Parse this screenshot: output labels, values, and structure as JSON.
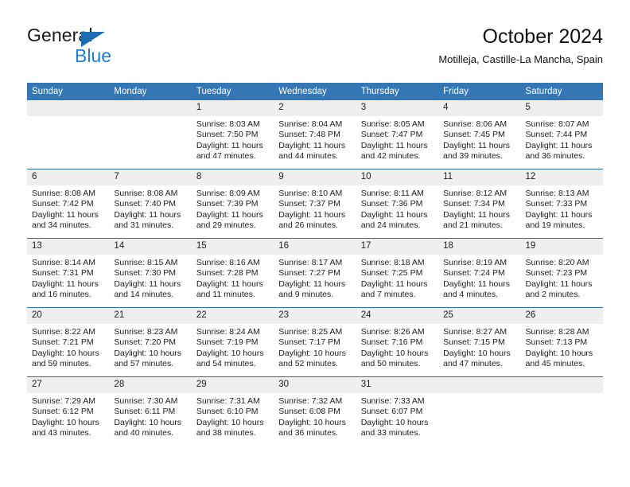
{
  "brand": {
    "name_top": "General",
    "name_bottom": "Blue",
    "accent_color": "#1b7fd0",
    "triangle_color": "#1b6cb0"
  },
  "header": {
    "title": "October 2024",
    "subtitle": "Motilleja, Castille-La Mancha, Spain"
  },
  "theme": {
    "header_blue": "#3477b4",
    "row_divider_blue": "#2f6ea8",
    "daynum_band": "#efefef"
  },
  "weekday_headers": [
    "Sunday",
    "Monday",
    "Tuesday",
    "Wednesday",
    "Thursday",
    "Friday",
    "Saturday"
  ],
  "weeks": [
    [
      {
        "day": "",
        "sunrise": "",
        "sunset": "",
        "daylight_line1": "",
        "daylight_line2": "",
        "empty": true
      },
      {
        "day": "",
        "sunrise": "",
        "sunset": "",
        "daylight_line1": "",
        "daylight_line2": "",
        "empty": true
      },
      {
        "day": "1",
        "sunrise": "Sunrise: 8:03 AM",
        "sunset": "Sunset: 7:50 PM",
        "daylight_line1": "Daylight: 11 hours",
        "daylight_line2": "and 47 minutes."
      },
      {
        "day": "2",
        "sunrise": "Sunrise: 8:04 AM",
        "sunset": "Sunset: 7:48 PM",
        "daylight_line1": "Daylight: 11 hours",
        "daylight_line2": "and 44 minutes."
      },
      {
        "day": "3",
        "sunrise": "Sunrise: 8:05 AM",
        "sunset": "Sunset: 7:47 PM",
        "daylight_line1": "Daylight: 11 hours",
        "daylight_line2": "and 42 minutes."
      },
      {
        "day": "4",
        "sunrise": "Sunrise: 8:06 AM",
        "sunset": "Sunset: 7:45 PM",
        "daylight_line1": "Daylight: 11 hours",
        "daylight_line2": "and 39 minutes."
      },
      {
        "day": "5",
        "sunrise": "Sunrise: 8:07 AM",
        "sunset": "Sunset: 7:44 PM",
        "daylight_line1": "Daylight: 11 hours",
        "daylight_line2": "and 36 minutes."
      }
    ],
    [
      {
        "day": "6",
        "sunrise": "Sunrise: 8:08 AM",
        "sunset": "Sunset: 7:42 PM",
        "daylight_line1": "Daylight: 11 hours",
        "daylight_line2": "and 34 minutes."
      },
      {
        "day": "7",
        "sunrise": "Sunrise: 8:08 AM",
        "sunset": "Sunset: 7:40 PM",
        "daylight_line1": "Daylight: 11 hours",
        "daylight_line2": "and 31 minutes."
      },
      {
        "day": "8",
        "sunrise": "Sunrise: 8:09 AM",
        "sunset": "Sunset: 7:39 PM",
        "daylight_line1": "Daylight: 11 hours",
        "daylight_line2": "and 29 minutes."
      },
      {
        "day": "9",
        "sunrise": "Sunrise: 8:10 AM",
        "sunset": "Sunset: 7:37 PM",
        "daylight_line1": "Daylight: 11 hours",
        "daylight_line2": "and 26 minutes."
      },
      {
        "day": "10",
        "sunrise": "Sunrise: 8:11 AM",
        "sunset": "Sunset: 7:36 PM",
        "daylight_line1": "Daylight: 11 hours",
        "daylight_line2": "and 24 minutes."
      },
      {
        "day": "11",
        "sunrise": "Sunrise: 8:12 AM",
        "sunset": "Sunset: 7:34 PM",
        "daylight_line1": "Daylight: 11 hours",
        "daylight_line2": "and 21 minutes."
      },
      {
        "day": "12",
        "sunrise": "Sunrise: 8:13 AM",
        "sunset": "Sunset: 7:33 PM",
        "daylight_line1": "Daylight: 11 hours",
        "daylight_line2": "and 19 minutes."
      }
    ],
    [
      {
        "day": "13",
        "sunrise": "Sunrise: 8:14 AM",
        "sunset": "Sunset: 7:31 PM",
        "daylight_line1": "Daylight: 11 hours",
        "daylight_line2": "and 16 minutes."
      },
      {
        "day": "14",
        "sunrise": "Sunrise: 8:15 AM",
        "sunset": "Sunset: 7:30 PM",
        "daylight_line1": "Daylight: 11 hours",
        "daylight_line2": "and 14 minutes."
      },
      {
        "day": "15",
        "sunrise": "Sunrise: 8:16 AM",
        "sunset": "Sunset: 7:28 PM",
        "daylight_line1": "Daylight: 11 hours",
        "daylight_line2": "and 11 minutes."
      },
      {
        "day": "16",
        "sunrise": "Sunrise: 8:17 AM",
        "sunset": "Sunset: 7:27 PM",
        "daylight_line1": "Daylight: 11 hours",
        "daylight_line2": "and 9 minutes."
      },
      {
        "day": "17",
        "sunrise": "Sunrise: 8:18 AM",
        "sunset": "Sunset: 7:25 PM",
        "daylight_line1": "Daylight: 11 hours",
        "daylight_line2": "and 7 minutes."
      },
      {
        "day": "18",
        "sunrise": "Sunrise: 8:19 AM",
        "sunset": "Sunset: 7:24 PM",
        "daylight_line1": "Daylight: 11 hours",
        "daylight_line2": "and 4 minutes."
      },
      {
        "day": "19",
        "sunrise": "Sunrise: 8:20 AM",
        "sunset": "Sunset: 7:23 PM",
        "daylight_line1": "Daylight: 11 hours",
        "daylight_line2": "and 2 minutes."
      }
    ],
    [
      {
        "day": "20",
        "sunrise": "Sunrise: 8:22 AM",
        "sunset": "Sunset: 7:21 PM",
        "daylight_line1": "Daylight: 10 hours",
        "daylight_line2": "and 59 minutes."
      },
      {
        "day": "21",
        "sunrise": "Sunrise: 8:23 AM",
        "sunset": "Sunset: 7:20 PM",
        "daylight_line1": "Daylight: 10 hours",
        "daylight_line2": "and 57 minutes."
      },
      {
        "day": "22",
        "sunrise": "Sunrise: 8:24 AM",
        "sunset": "Sunset: 7:19 PM",
        "daylight_line1": "Daylight: 10 hours",
        "daylight_line2": "and 54 minutes."
      },
      {
        "day": "23",
        "sunrise": "Sunrise: 8:25 AM",
        "sunset": "Sunset: 7:17 PM",
        "daylight_line1": "Daylight: 10 hours",
        "daylight_line2": "and 52 minutes."
      },
      {
        "day": "24",
        "sunrise": "Sunrise: 8:26 AM",
        "sunset": "Sunset: 7:16 PM",
        "daylight_line1": "Daylight: 10 hours",
        "daylight_line2": "and 50 minutes."
      },
      {
        "day": "25",
        "sunrise": "Sunrise: 8:27 AM",
        "sunset": "Sunset: 7:15 PM",
        "daylight_line1": "Daylight: 10 hours",
        "daylight_line2": "and 47 minutes."
      },
      {
        "day": "26",
        "sunrise": "Sunrise: 8:28 AM",
        "sunset": "Sunset: 7:13 PM",
        "daylight_line1": "Daylight: 10 hours",
        "daylight_line2": "and 45 minutes."
      }
    ],
    [
      {
        "day": "27",
        "sunrise": "Sunrise: 7:29 AM",
        "sunset": "Sunset: 6:12 PM",
        "daylight_line1": "Daylight: 10 hours",
        "daylight_line2": "and 43 minutes."
      },
      {
        "day": "28",
        "sunrise": "Sunrise: 7:30 AM",
        "sunset": "Sunset: 6:11 PM",
        "daylight_line1": "Daylight: 10 hours",
        "daylight_line2": "and 40 minutes."
      },
      {
        "day": "29",
        "sunrise": "Sunrise: 7:31 AM",
        "sunset": "Sunset: 6:10 PM",
        "daylight_line1": "Daylight: 10 hours",
        "daylight_line2": "and 38 minutes."
      },
      {
        "day": "30",
        "sunrise": "Sunrise: 7:32 AM",
        "sunset": "Sunset: 6:08 PM",
        "daylight_line1": "Daylight: 10 hours",
        "daylight_line2": "and 36 minutes."
      },
      {
        "day": "31",
        "sunrise": "Sunrise: 7:33 AM",
        "sunset": "Sunset: 6:07 PM",
        "daylight_line1": "Daylight: 10 hours",
        "daylight_line2": "and 33 minutes."
      },
      {
        "day": "",
        "sunrise": "",
        "sunset": "",
        "daylight_line1": "",
        "daylight_line2": "",
        "empty": true
      },
      {
        "day": "",
        "sunrise": "",
        "sunset": "",
        "daylight_line1": "",
        "daylight_line2": "",
        "empty": true
      }
    ]
  ]
}
